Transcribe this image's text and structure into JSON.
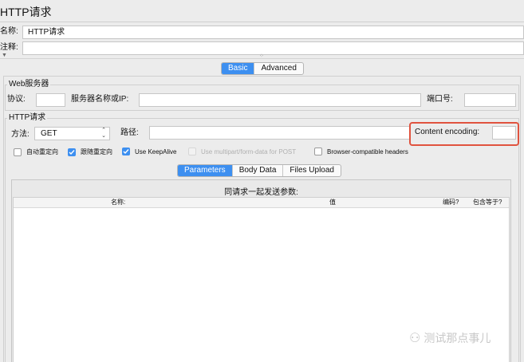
{
  "window": {
    "title": "HTTP请求"
  },
  "name_row": {
    "label": "名称:",
    "value": "HTTP请求"
  },
  "comment_row": {
    "label": "注释:",
    "value": ""
  },
  "main_tabs": [
    {
      "label": "Basic",
      "active": true
    },
    {
      "label": "Advanced",
      "active": false
    }
  ],
  "web_server": {
    "legend": "Web服务器",
    "protocol_label": "协议:",
    "protocol_value": "",
    "server_label": "服务器名称或IP:",
    "server_value": "",
    "port_label": "端口号:",
    "port_value": ""
  },
  "http_request": {
    "legend": "HTTP请求",
    "method_label": "方法:",
    "method_value": "GET",
    "path_label": "路径:",
    "path_value": "",
    "encoding_label": "Content encoding:",
    "encoding_value": "",
    "highlight_color": "#e0533f"
  },
  "options": [
    {
      "label": "自动重定向",
      "checked": false,
      "disabled": false
    },
    {
      "label": "跟随重定向",
      "checked": true,
      "disabled": false
    },
    {
      "label": "Use KeepAlive",
      "checked": true,
      "disabled": false
    },
    {
      "label": "Use multipart/form-data for POST",
      "checked": false,
      "disabled": true
    },
    {
      "label": "Browser-compatible headers",
      "checked": false,
      "disabled": false
    }
  ],
  "sub_tabs": [
    {
      "label": "Parameters",
      "active": true
    },
    {
      "label": "Body Data",
      "active": false
    },
    {
      "label": "Files Upload",
      "active": false
    }
  ],
  "params_table": {
    "title": "同请求一起发送参数:",
    "columns": [
      "名称:",
      "值",
      "编码?",
      "包含等于?"
    ],
    "rows": []
  },
  "watermark": "测试那点事儿",
  "accent_color": "#3d8ff0"
}
